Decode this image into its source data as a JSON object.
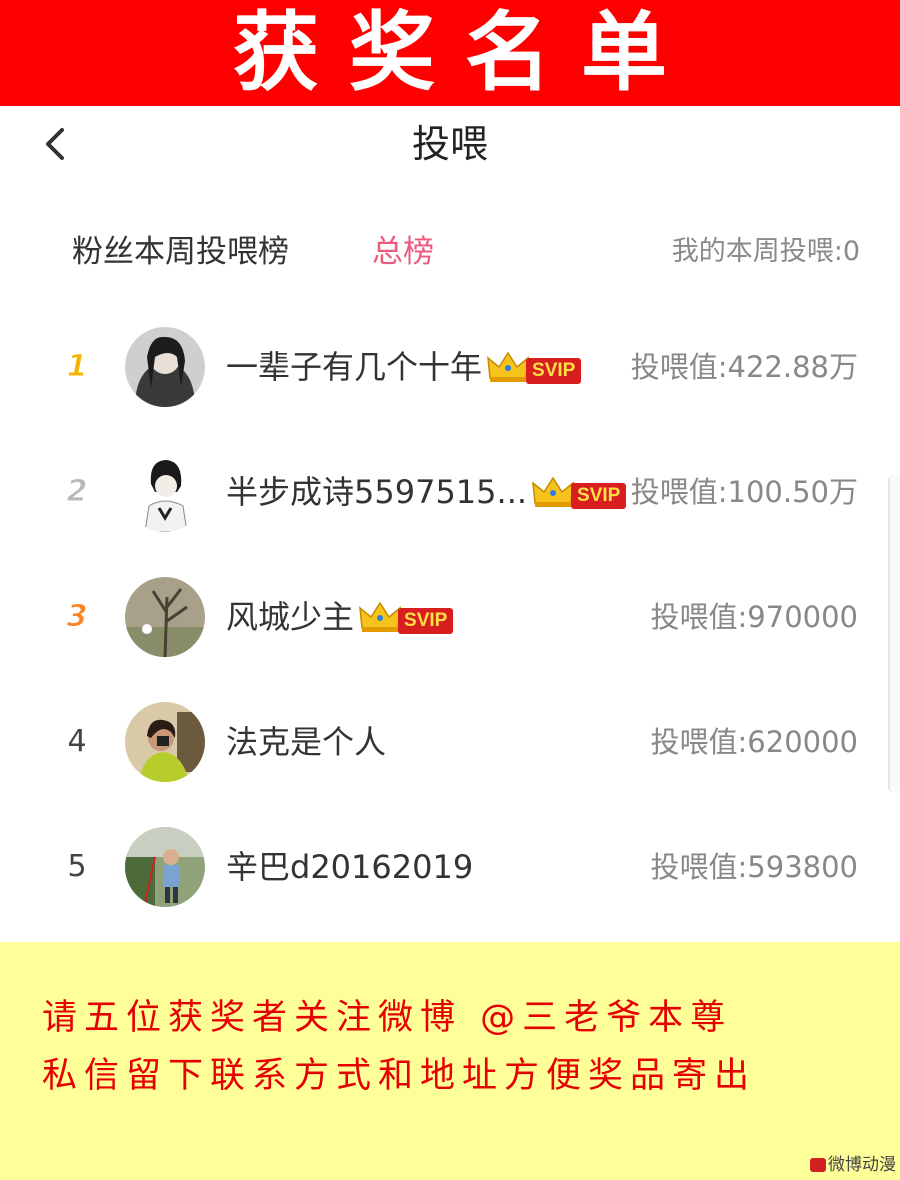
{
  "banner": {
    "title": "获奖名单"
  },
  "nav": {
    "back_icon": "chevron-left-icon",
    "title": "投喂"
  },
  "tabs": {
    "weekly": "粉丝本周投喂榜",
    "total": "总榜",
    "my_weekly": "我的本周投喂:0"
  },
  "colors": {
    "banner": "#ff0000",
    "active_tab": "#ee5a7e",
    "notice_bg": "#ffff99",
    "notice_text": "#e60000"
  },
  "rows": [
    {
      "rank": "1",
      "name": "一辈子有几个十年",
      "svip": true,
      "badge": "SVIP",
      "value": "投喂值:422.88万",
      "rank_color": "#f5b400"
    },
    {
      "rank": "2",
      "name": "半步成诗5597515...",
      "svip": true,
      "badge": "SVIP",
      "value": "投喂值:100.50万",
      "rank_color": "#b8b8b8"
    },
    {
      "rank": "3",
      "name": "风城少主",
      "svip": true,
      "badge": "SVIP",
      "value": "投喂值:970000",
      "rank_color": "#f5862a"
    },
    {
      "rank": "4",
      "name": "法克是个人",
      "svip": false,
      "badge": "",
      "value": "投喂值:620000",
      "rank_color": "#444444"
    },
    {
      "rank": "5",
      "name": "辛巴d20162019",
      "svip": false,
      "badge": "",
      "value": "投喂值:593800",
      "rank_color": "#444444"
    }
  ],
  "notice": {
    "line1": "请五位获奖者关注微博 @三老爷本尊",
    "line2": "私信留下联系方式和地址方便奖品寄出"
  },
  "watermark": "微博动漫"
}
